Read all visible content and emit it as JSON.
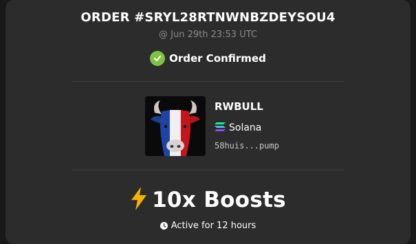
{
  "order": {
    "title": "ORDER #SRYL28RTNWNBZDEYSOU4",
    "timestamp": "@ Jun 29th 23:53 UTC",
    "status": "Order Confirmed",
    "status_icon": "check-circle-icon",
    "status_color": "#7fc241"
  },
  "token": {
    "name": "RWBULL",
    "chain": "Solana",
    "chain_icon": "solana-icon",
    "address": "58huis...pump",
    "image": "bull-image"
  },
  "boost": {
    "label": "10x Boosts",
    "icon": "lightning-icon",
    "duration": "Active for 12 hours",
    "duration_icon": "clock-icon"
  },
  "colors": {
    "background": "#191919",
    "card": "#2c2c2c",
    "accent_lightning": "#f5b400"
  }
}
